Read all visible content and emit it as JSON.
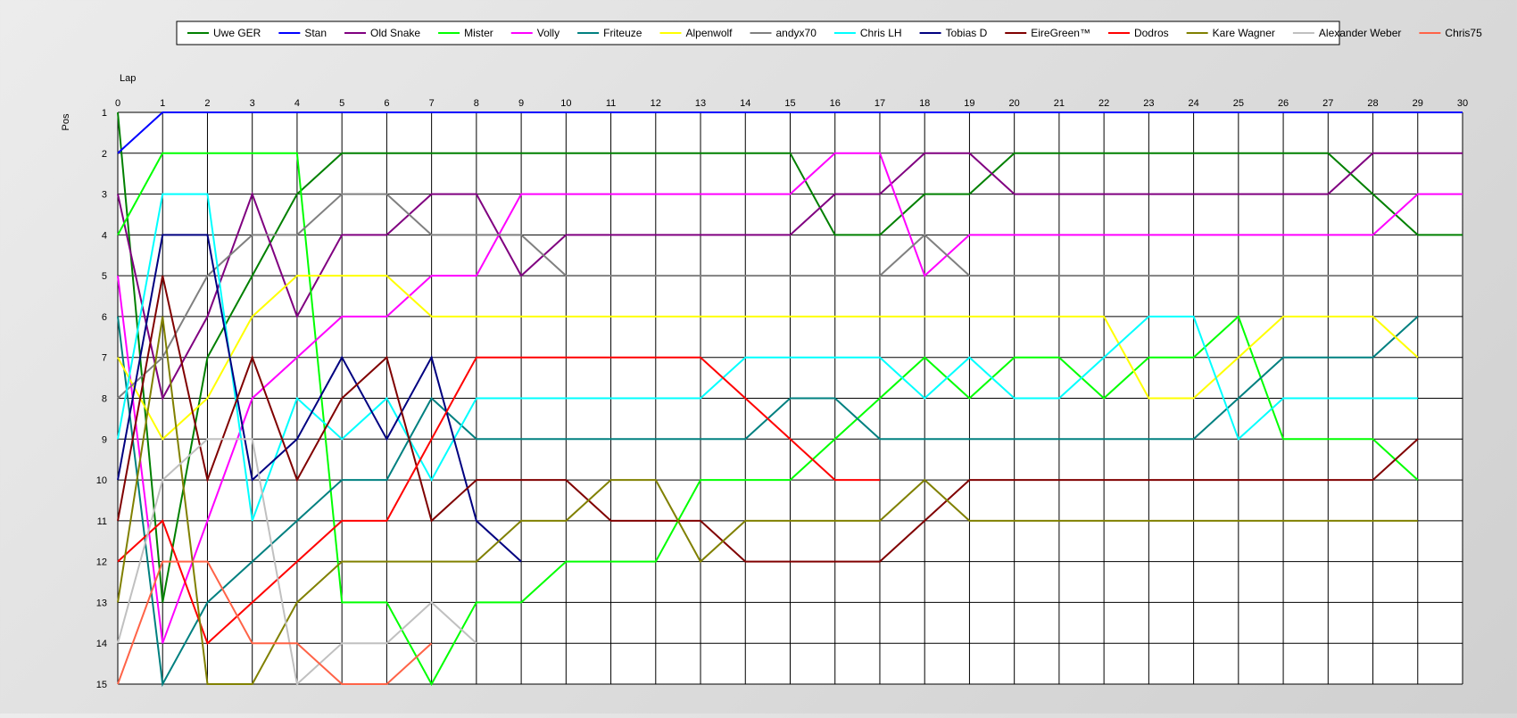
{
  "chart_data": {
    "type": "line",
    "title": "",
    "xlabel": "Lap",
    "ylabel": "Pos",
    "xlim": [
      0,
      30
    ],
    "ylim": [
      1,
      15
    ],
    "y_reversed": true,
    "grid": true,
    "legend_position": "top-center",
    "x_ticks": [
      "0",
      "1",
      "2",
      "3",
      "4",
      "5",
      "6",
      "7",
      "8",
      "9",
      "10",
      "11",
      "12",
      "13",
      "14",
      "15",
      "16",
      "17",
      "18",
      "19",
      "20",
      "21",
      "22",
      "23",
      "24",
      "25",
      "26",
      "27",
      "28",
      "29",
      "30"
    ],
    "y_ticks": [
      "1",
      "2",
      "3",
      "4",
      "5",
      "6",
      "7",
      "8",
      "9",
      "10",
      "11",
      "12",
      "13",
      "14",
      "15"
    ],
    "series": [
      {
        "name": "Uwe GER",
        "color": "#008000",
        "values": [
          1,
          13,
          7,
          5,
          3,
          2,
          2,
          2,
          2,
          2,
          2,
          2,
          2,
          2,
          2,
          2,
          4,
          4,
          3,
          3,
          2,
          2,
          2,
          2,
          2,
          2,
          2,
          2,
          3,
          4,
          4
        ]
      },
      {
        "name": "Stan",
        "color": "#0000ff",
        "values": [
          2,
          1,
          1,
          1,
          1,
          1,
          1,
          1,
          1,
          1,
          1,
          1,
          1,
          1,
          1,
          1,
          1,
          1,
          1,
          1,
          1,
          1,
          1,
          1,
          1,
          1,
          1,
          1,
          1,
          1,
          1
        ]
      },
      {
        "name": "Old Snake",
        "color": "#800080",
        "values": [
          3,
          8,
          6,
          3,
          6,
          4,
          4,
          3,
          3,
          5,
          4,
          4,
          4,
          4,
          4,
          4,
          3,
          3,
          2,
          2,
          3,
          3,
          3,
          3,
          3,
          3,
          3,
          3,
          2,
          2,
          2
        ]
      },
      {
        "name": "Mister",
        "color": "#00ff00",
        "values": [
          4,
          2,
          2,
          2,
          2,
          13,
          13,
          15,
          13,
          13,
          12,
          12,
          12,
          10,
          10,
          10,
          9,
          8,
          7,
          8,
          7,
          7,
          8,
          7,
          7,
          6,
          9,
          9,
          9,
          10,
          null
        ]
      },
      {
        "name": "Volly",
        "color": "#ff00ff",
        "values": [
          5,
          14,
          11,
          8,
          7,
          6,
          6,
          5,
          5,
          3,
          3,
          3,
          3,
          3,
          3,
          3,
          2,
          2,
          5,
          4,
          4,
          4,
          4,
          4,
          4,
          4,
          4,
          4,
          4,
          3,
          3
        ]
      },
      {
        "name": "Friteuze",
        "color": "#008080",
        "values": [
          6,
          15,
          13,
          12,
          11,
          10,
          10,
          8,
          9,
          9,
          9,
          9,
          9,
          9,
          9,
          8,
          8,
          9,
          9,
          9,
          9,
          9,
          9,
          9,
          9,
          8,
          7,
          7,
          7,
          6,
          null
        ]
      },
      {
        "name": "Alpenwolf",
        "color": "#ffff00",
        "values": [
          7,
          9,
          8,
          6,
          5,
          5,
          5,
          6,
          6,
          6,
          6,
          6,
          6,
          6,
          6,
          6,
          6,
          6,
          6,
          6,
          6,
          6,
          6,
          8,
          8,
          7,
          6,
          6,
          6,
          7,
          null
        ]
      },
      {
        "name": "andyx70",
        "color": "#808080",
        "values": [
          8,
          7,
          5,
          4,
          4,
          3,
          3,
          4,
          4,
          4,
          5,
          5,
          5,
          5,
          5,
          5,
          5,
          5,
          4,
          5,
          5,
          5,
          5,
          5,
          5,
          5,
          5,
          5,
          5,
          5,
          5
        ]
      },
      {
        "name": "Chris LH",
        "color": "#00ffff",
        "values": [
          9,
          3,
          3,
          11,
          8,
          9,
          8,
          10,
          8,
          8,
          8,
          8,
          8,
          8,
          7,
          7,
          7,
          7,
          8,
          7,
          8,
          8,
          7,
          6,
          6,
          9,
          8,
          8,
          8,
          8,
          null
        ]
      },
      {
        "name": "Tobias D",
        "color": "#000080",
        "values": [
          10,
          4,
          4,
          10,
          9,
          7,
          9,
          7,
          11,
          12,
          null,
          null,
          null,
          null,
          null,
          null,
          null,
          null,
          null,
          null,
          null,
          null,
          null,
          null,
          null,
          null,
          null,
          null,
          null,
          null,
          null
        ]
      },
      {
        "name": "EireGreen™",
        "color": "#800000",
        "values": [
          11,
          5,
          10,
          7,
          10,
          8,
          7,
          11,
          10,
          10,
          10,
          11,
          11,
          11,
          12,
          12,
          12,
          12,
          11,
          10,
          10,
          10,
          10,
          10,
          10,
          10,
          10,
          10,
          10,
          9,
          null
        ]
      },
      {
        "name": "Dodros",
        "color": "#ff0000",
        "values": [
          12,
          11,
          14,
          13,
          12,
          11,
          11,
          9,
          7,
          7,
          7,
          7,
          7,
          7,
          8,
          9,
          10,
          10,
          null,
          null,
          null,
          null,
          null,
          null,
          null,
          null,
          null,
          null,
          null,
          null,
          null
        ]
      },
      {
        "name": "Kare Wagner",
        "color": "#808000",
        "values": [
          13,
          6,
          15,
          15,
          13,
          12,
          12,
          12,
          12,
          11,
          11,
          10,
          10,
          12,
          11,
          11,
          11,
          11,
          10,
          11,
          11,
          11,
          11,
          11,
          11,
          11,
          11,
          11,
          11,
          11,
          null
        ]
      },
      {
        "name": "Alexander Weber",
        "color": "#c0c0c0",
        "values": [
          14,
          10,
          9,
          9,
          15,
          14,
          14,
          13,
          14,
          null,
          null,
          null,
          null,
          null,
          null,
          null,
          null,
          null,
          null,
          null,
          null,
          null,
          null,
          null,
          null,
          null,
          null,
          null,
          null,
          null,
          null
        ]
      },
      {
        "name": "Chris75",
        "color": "#ff6347",
        "values": [
          15,
          12,
          12,
          14,
          14,
          15,
          15,
          14,
          null,
          null,
          null,
          null,
          null,
          null,
          null,
          null,
          null,
          null,
          null,
          null,
          null,
          null,
          null,
          null,
          null,
          null,
          null,
          null,
          null,
          null,
          null
        ]
      }
    ]
  }
}
